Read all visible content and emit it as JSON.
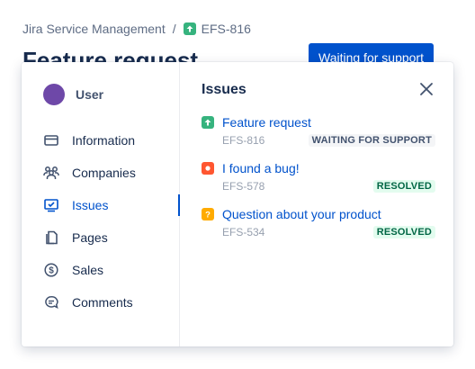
{
  "breadcrumb": {
    "project": "Jira Service Management",
    "separator": "/",
    "issue_key": "EFS-816"
  },
  "page": {
    "title": "Feature request",
    "status_button": "Waiting for support"
  },
  "panel": {
    "user": {
      "name": "User",
      "avatar_color": "#6e48a8"
    },
    "nav": [
      {
        "label": "Information",
        "icon": "card-icon",
        "active": false
      },
      {
        "label": "Companies",
        "icon": "people-group-icon",
        "active": false
      },
      {
        "label": "Issues",
        "icon": "screen-icon",
        "active": true
      },
      {
        "label": "Pages",
        "icon": "pages-icon",
        "active": false
      },
      {
        "label": "Sales",
        "icon": "dollar-icon",
        "active": false
      },
      {
        "label": "Comments",
        "icon": "comment-icon",
        "active": false
      }
    ],
    "content_title": "Issues",
    "issues": [
      {
        "summary": "Feature request",
        "key": "EFS-816",
        "status": "WAITING FOR SUPPORT",
        "type": "story",
        "type_color": "#36b37e"
      },
      {
        "summary": "I found a bug!",
        "key": "EFS-578",
        "status": "RESOLVED",
        "type": "bug",
        "type_color": "#ff5630"
      },
      {
        "summary": "Question about your product",
        "key": "EFS-534",
        "status": "RESOLVED",
        "type": "question",
        "type_color": "#ffab00"
      }
    ]
  },
  "colors": {
    "primary": "#0052cc",
    "text": "#172b4d",
    "subtle": "#97a0af",
    "resolved_bg": "#e3fcef",
    "resolved_text": "#006644"
  }
}
